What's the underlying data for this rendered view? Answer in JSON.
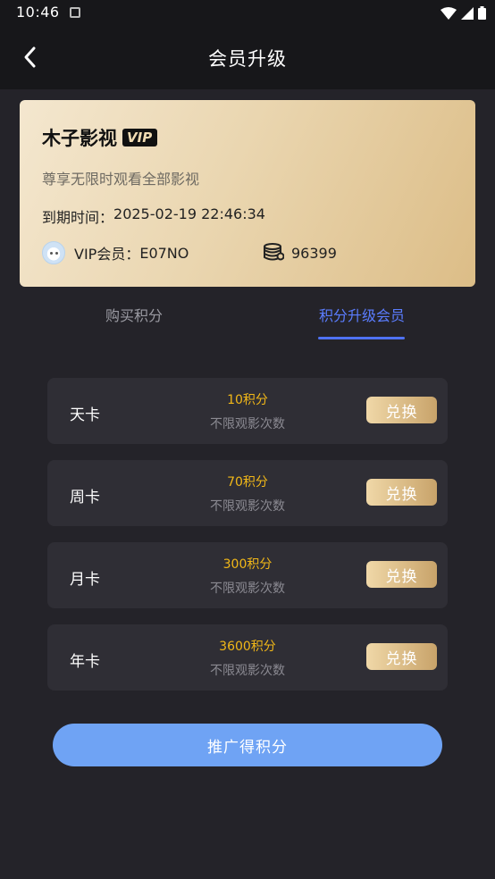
{
  "status_bar": {
    "time": "10:46"
  },
  "header": {
    "title": "会员升级"
  },
  "vip_card": {
    "app_name": "木子影视",
    "badge": "VIP",
    "description": "尊享无限时观看全部影视",
    "expiry_label": "到期时间：",
    "expiry_value": "2025-02-19 22:46:34",
    "member_label": "VIP会员：",
    "member_id": "E07NO",
    "points": "96399"
  },
  "tabs": [
    {
      "label": "购买积分",
      "active": false
    },
    {
      "label": "积分升级会员",
      "active": true
    }
  ],
  "plans": [
    {
      "name": "天卡",
      "points": "10积分",
      "desc": "不限观影次数",
      "button": "兑换"
    },
    {
      "name": "周卡",
      "points": "70积分",
      "desc": "不限观影次数",
      "button": "兑换"
    },
    {
      "name": "月卡",
      "points": "300积分",
      "desc": "不限观影次数",
      "button": "兑换"
    },
    {
      "name": "年卡",
      "points": "3600积分",
      "desc": "不限观影次数",
      "button": "兑换"
    }
  ],
  "promote_button": "推广得积分",
  "colors": {
    "background": "#242329",
    "card": "#2f2e35",
    "accent_blue": "#5b7dff",
    "points_gold": "#f2b818",
    "promote_button": "#6fa3f4"
  }
}
